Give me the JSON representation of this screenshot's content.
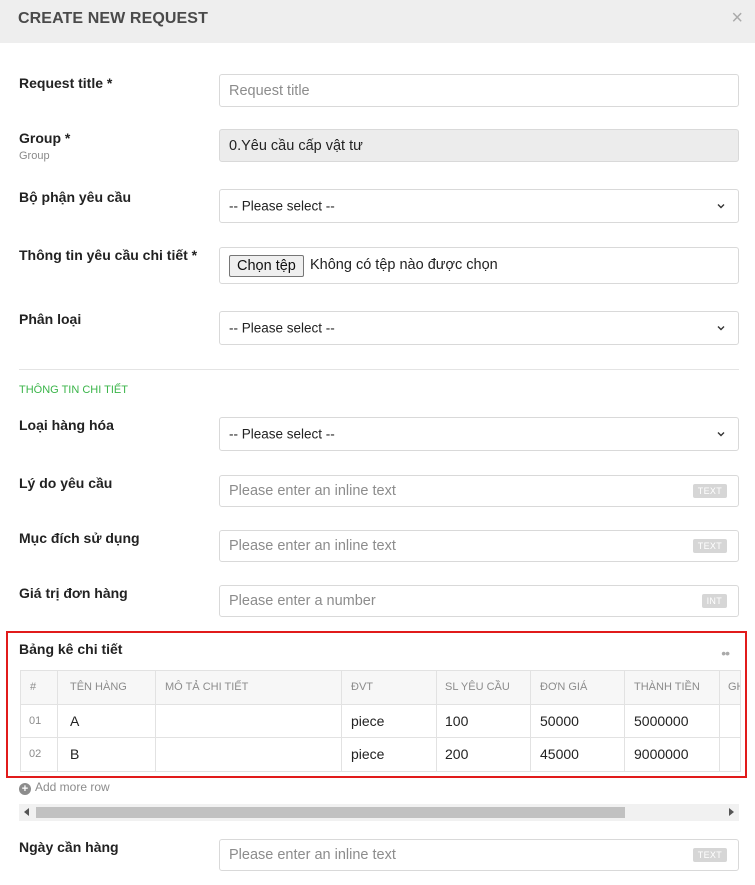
{
  "dialog": {
    "title": "CREATE NEW REQUEST",
    "close_symbol": "×"
  },
  "fields": {
    "request_title": {
      "label": "Request title *",
      "placeholder": "Request title"
    },
    "group": {
      "label": "Group *",
      "sublabel": "Group",
      "value": "0.Yêu cầu cấp vật tư"
    },
    "department": {
      "label": "Bộ phận yêu cầu",
      "value": "-- Please select --"
    },
    "detail_file": {
      "label": "Thông tin yêu cầu chi tiết *",
      "button": "Chọn tệp",
      "status": "Không có tệp nào được chọn"
    },
    "classification": {
      "label": "Phân loại",
      "value": "-- Please select --"
    }
  },
  "section_title": "THÔNG TIN CHI TIẾT",
  "details": {
    "goods_type": {
      "label": "Loại hàng hóa",
      "value": "-- Please select --"
    },
    "reason": {
      "label": "Lý do yêu cầu",
      "placeholder": "Please enter an inline text",
      "badge": "TEXT"
    },
    "purpose": {
      "label": "Mục đích sử dụng",
      "placeholder": "Please enter an inline text",
      "badge": "TEXT"
    },
    "order_value": {
      "label": "Giá trị đơn hàng",
      "placeholder": "Please enter a number",
      "badge": "INT"
    }
  },
  "table": {
    "title": "Bảng kê chi tiết",
    "menu_symbol": "••",
    "headers": [
      "#",
      "TÊN HÀNG",
      "MÔ TẢ CHI TIẾT",
      "ĐVT",
      "SL YÊU CẦU",
      "ĐƠN GIÁ",
      "THÀNH TIỀN",
      "GH"
    ],
    "rows": [
      {
        "index": "01",
        "name": "A",
        "description": "",
        "unit": "piece",
        "quantity": "100",
        "unit_price": "50000",
        "total": "5000000"
      },
      {
        "index": "02",
        "name": "B",
        "description": "",
        "unit": "piece",
        "quantity": "200",
        "unit_price": "45000",
        "total": "9000000"
      }
    ],
    "add_row": "Add more row"
  },
  "need_date": {
    "label": "Ngày cần hàng",
    "placeholder": "Please enter an inline text",
    "badge": "TEXT"
  }
}
